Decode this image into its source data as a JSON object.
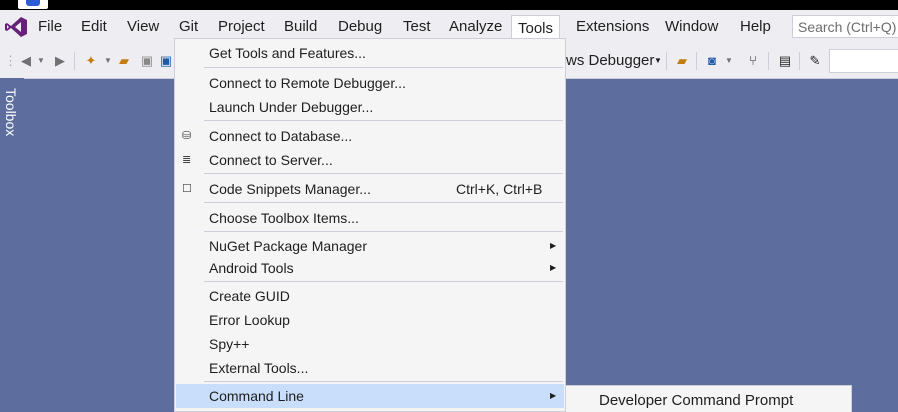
{
  "menubar": {
    "items": [
      "File",
      "Edit",
      "View",
      "Git",
      "Project",
      "Build",
      "Debug",
      "Test",
      "Analyze",
      "Tools",
      "Extensions",
      "Window",
      "Help"
    ],
    "active": "Tools"
  },
  "search": {
    "placeholder": "Search (Ctrl+Q)"
  },
  "toolbar": {
    "debugger_label": "ws Debugger"
  },
  "toolbox": {
    "label": "Toolbox"
  },
  "tools_menu": {
    "items": [
      {
        "label": "Get Tools and Features...",
        "shortcut": "",
        "submenu": false
      },
      {
        "label": "Connect to Remote Debugger...",
        "shortcut": "",
        "submenu": false
      },
      {
        "label": "Launch Under Debugger...",
        "shortcut": "",
        "submenu": false
      },
      {
        "label": "Connect to Database...",
        "shortcut": "",
        "submenu": false
      },
      {
        "label": "Connect to Server...",
        "shortcut": "",
        "submenu": false
      },
      {
        "label": "Code Snippets Manager...",
        "shortcut": "Ctrl+K, Ctrl+B",
        "submenu": false
      },
      {
        "label": "Choose Toolbox Items...",
        "shortcut": "",
        "submenu": false
      },
      {
        "label": "NuGet Package Manager",
        "shortcut": "",
        "submenu": true
      },
      {
        "label": "Android Tools",
        "shortcut": "",
        "submenu": true
      },
      {
        "label": "Create GUID",
        "shortcut": "",
        "submenu": false
      },
      {
        "label": "Error Lookup",
        "shortcut": "",
        "submenu": false
      },
      {
        "label": "Spy++",
        "shortcut": "",
        "submenu": false
      },
      {
        "label": "External Tools...",
        "shortcut": "",
        "submenu": false
      },
      {
        "label": "Command Line",
        "shortcut": "",
        "submenu": true,
        "highlighted": true
      }
    ]
  },
  "command_line_submenu": {
    "items": [
      "Developer Command Prompt"
    ]
  },
  "colors": {
    "background": "#5c6d9e",
    "menubar": "#eeeef2",
    "menu_bg": "#f5f5f5",
    "highlight": "#c9defa",
    "vs_logo": "#68217a"
  }
}
